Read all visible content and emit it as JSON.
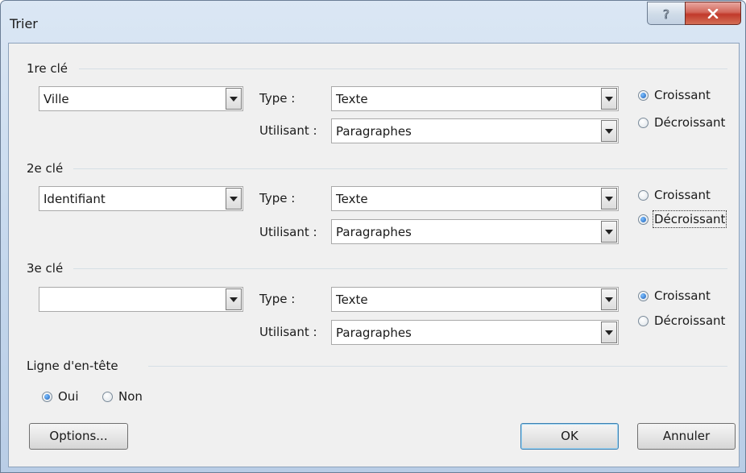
{
  "window": {
    "title": "Trier",
    "help_glyph": "?",
    "close_glyph": "X"
  },
  "key1": {
    "group_label": "1re clé",
    "field_value": "Ville",
    "type_label": "Type :",
    "type_value": "Texte",
    "using_label": "Utilisant :",
    "using_value": "Paragraphes",
    "asc_label": "Croissant",
    "desc_label": "Décroissant",
    "selected": "asc"
  },
  "key2": {
    "group_label": "2e clé",
    "field_value": "Identifiant",
    "type_label": "Type :",
    "type_value": "Texte",
    "using_label": "Utilisant :",
    "using_value": "Paragraphes",
    "asc_label": "Croissant",
    "desc_label": "Décroissant",
    "selected": "desc"
  },
  "key3": {
    "group_label": "3e clé",
    "field_value": "",
    "type_label": "Type :",
    "type_value": "Texte",
    "using_label": "Utilisant :",
    "using_value": "Paragraphes",
    "asc_label": "Croissant",
    "desc_label": "Décroissant",
    "selected": "asc"
  },
  "header_row": {
    "group_label": "Ligne d'en-tête",
    "yes_label": "Oui",
    "no_label": "Non",
    "selected": "yes"
  },
  "buttons": {
    "options_label": "Options...",
    "ok_label": "OK",
    "cancel_label": "Annuler"
  },
  "icons": {
    "help": "help-icon",
    "close": "close-icon",
    "dropdown": "chevron-down-icon",
    "radio": "radio-icon"
  }
}
